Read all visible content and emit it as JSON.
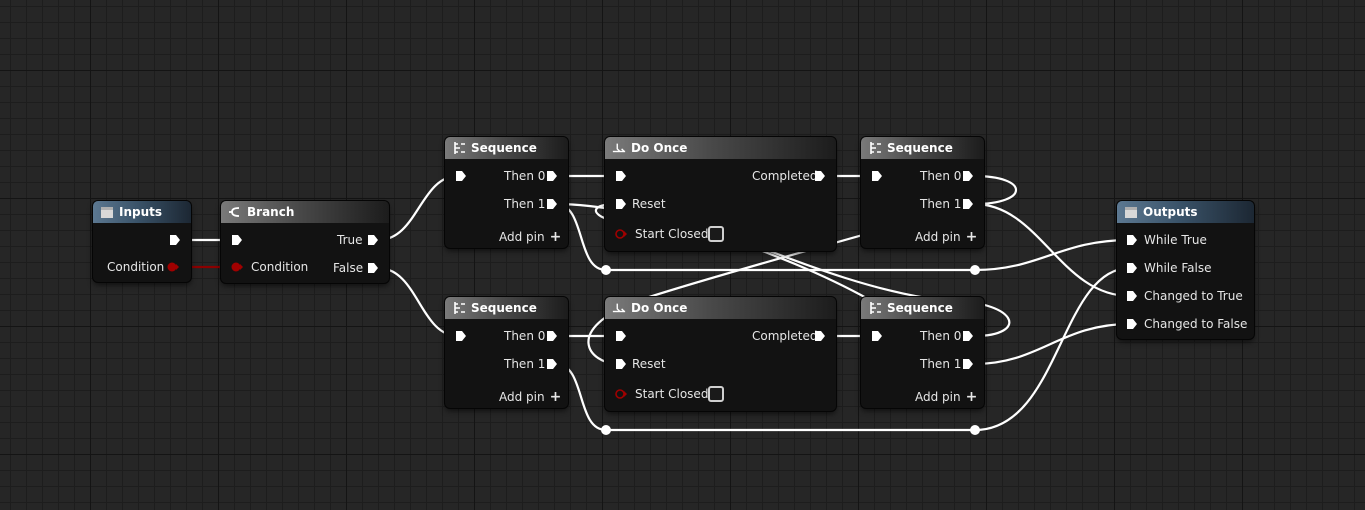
{
  "nodes": {
    "inputs": {
      "title": "Inputs",
      "condition_label": "Condition"
    },
    "branch": {
      "title": "Branch",
      "condition_label": "Condition",
      "true_label": "True",
      "false_label": "False"
    },
    "seq_a": {
      "title": "Sequence",
      "then0": "Then 0",
      "then1": "Then 1",
      "add_pin": "Add pin"
    },
    "doonce_a": {
      "title": "Do Once",
      "completed": "Completed",
      "reset": "Reset",
      "start_closed": "Start Closed"
    },
    "seq_b": {
      "title": "Sequence",
      "then0": "Then 0",
      "then1": "Then 1",
      "add_pin": "Add pin"
    },
    "seq_c": {
      "title": "Sequence",
      "then0": "Then 0",
      "then1": "Then 1",
      "add_pin": "Add pin"
    },
    "doonce_b": {
      "title": "Do Once",
      "completed": "Completed",
      "reset": "Reset",
      "start_closed": "Start Closed"
    },
    "seq_d": {
      "title": "Sequence",
      "then0": "Then 0",
      "then1": "Then 1",
      "add_pin": "Add pin"
    },
    "outputs": {
      "title": "Outputs",
      "while_true": "While True",
      "while_false": "While False",
      "changed_true": "Changed to True",
      "changed_false": "Changed to False"
    }
  },
  "colors": {
    "exec_wire": "#ffffff",
    "bool_pin": "#8c0000",
    "io_header": "#4d6a85",
    "node_header": "#6a6a6a"
  },
  "icons": {
    "io": "struct-icon",
    "branch": "branch-icon",
    "sequence": "sequence-icon",
    "do_once": "do-once-icon"
  }
}
